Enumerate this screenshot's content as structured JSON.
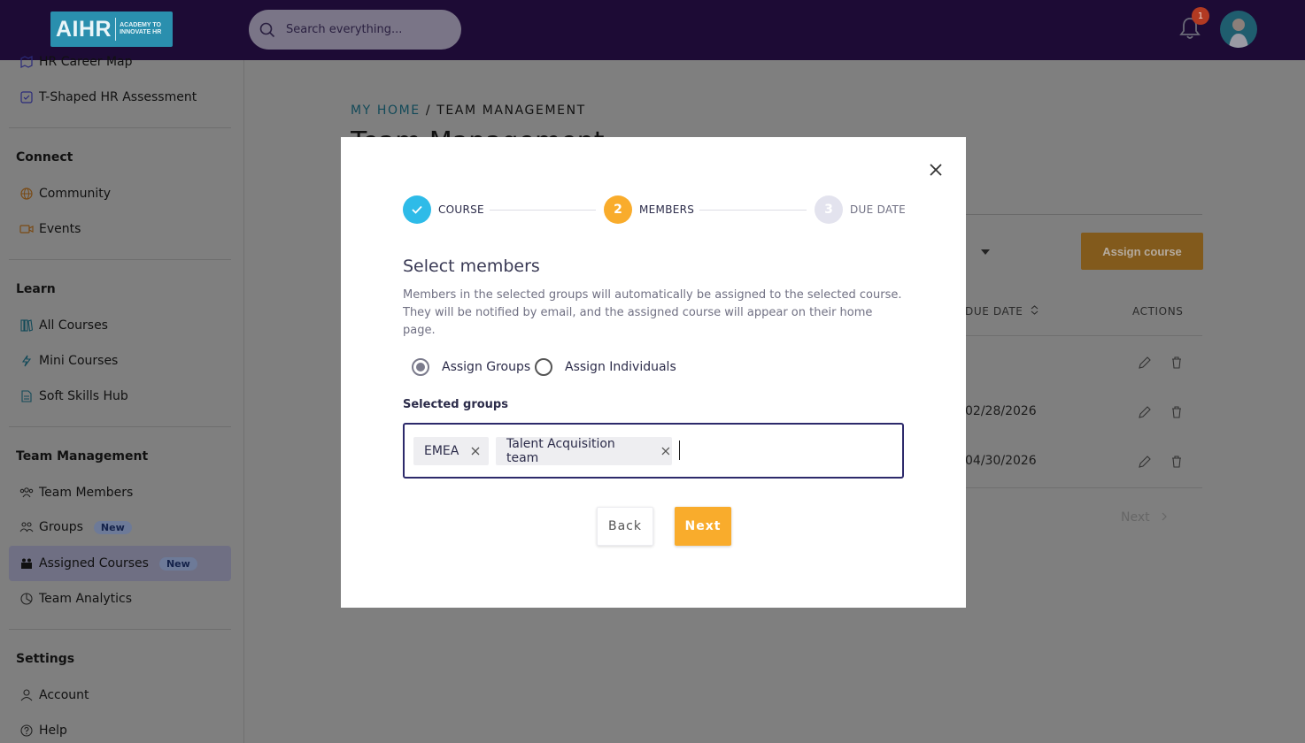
{
  "header": {
    "logo_text": "AIHR",
    "logo_subtext_line1": "ACADEMY TO",
    "logo_subtext_line2": "INNOVATE HR",
    "search_placeholder": "Search everything...",
    "notification_count": "1"
  },
  "sidebar": {
    "top_items": [
      {
        "label": "HR Career Map",
        "icon": "map-icon"
      },
      {
        "label": "T-Shaped HR Assessment",
        "icon": "checkbox-icon"
      }
    ],
    "sections": [
      {
        "title": "Connect",
        "items": [
          {
            "label": "Community",
            "icon": "globe-icon"
          },
          {
            "label": "Events",
            "icon": "video-icon"
          }
        ]
      },
      {
        "title": "Learn",
        "items": [
          {
            "label": "All Courses",
            "icon": "books-icon"
          },
          {
            "label": "Mini Courses",
            "icon": "lightning-icon"
          },
          {
            "label": "Soft Skills Hub",
            "icon": "document-icon"
          }
        ]
      },
      {
        "title": "Team Management",
        "items": [
          {
            "label": "Team Members",
            "icon": "team-icon"
          },
          {
            "label": "Groups",
            "icon": "group-icon",
            "badge": "New"
          },
          {
            "label": "Assigned Courses",
            "icon": "assigned-icon",
            "badge": "New",
            "active": true
          },
          {
            "label": "Team Analytics",
            "icon": "analytics-icon"
          }
        ]
      },
      {
        "title": "Settings",
        "items": [
          {
            "label": "Account",
            "icon": "user-icon"
          },
          {
            "label": "Help",
            "icon": "help-icon"
          }
        ]
      }
    ]
  },
  "main": {
    "breadcrumb_home": "MY HOME",
    "breadcrumb_sep": " / ",
    "breadcrumb_current": "TEAM MANAGEMENT",
    "page_title": "Team Management",
    "assign_button": "Assign course",
    "table_headers": {
      "due_date": "DUE DATE",
      "actions": "ACTIONS"
    },
    "rows": [
      {
        "due_date": ""
      },
      {
        "due_date": "02/28/2026"
      },
      {
        "due_date": "04/30/2026"
      }
    ],
    "pagination_next": "Next"
  },
  "modal": {
    "steps": [
      {
        "number": "",
        "label": "COURSE",
        "state": "done"
      },
      {
        "number": "2",
        "label": "MEMBERS",
        "state": "active"
      },
      {
        "number": "3",
        "label": "DUE DATE",
        "state": "pending"
      }
    ],
    "title": "Select members",
    "description": "Members in the selected groups will automatically be assigned to the selected course. They will be notified by email, and the assigned course will appear on their home page.",
    "radio_groups": "Assign Groups",
    "radio_individuals": "Assign Individuals",
    "selected_option": "groups",
    "selected_groups_label": "Selected groups",
    "selected_groups": [
      "EMEA",
      "Talent Acquisition team"
    ],
    "back_label": "Back",
    "next_label": "Next"
  },
  "colors": {
    "header_bg": "#1d0b35",
    "accent_orange": "#f9ac2c",
    "step_done": "#2ebbe8",
    "step_pending": "#e3e3ee",
    "tag_border": "#2d2a6b"
  }
}
